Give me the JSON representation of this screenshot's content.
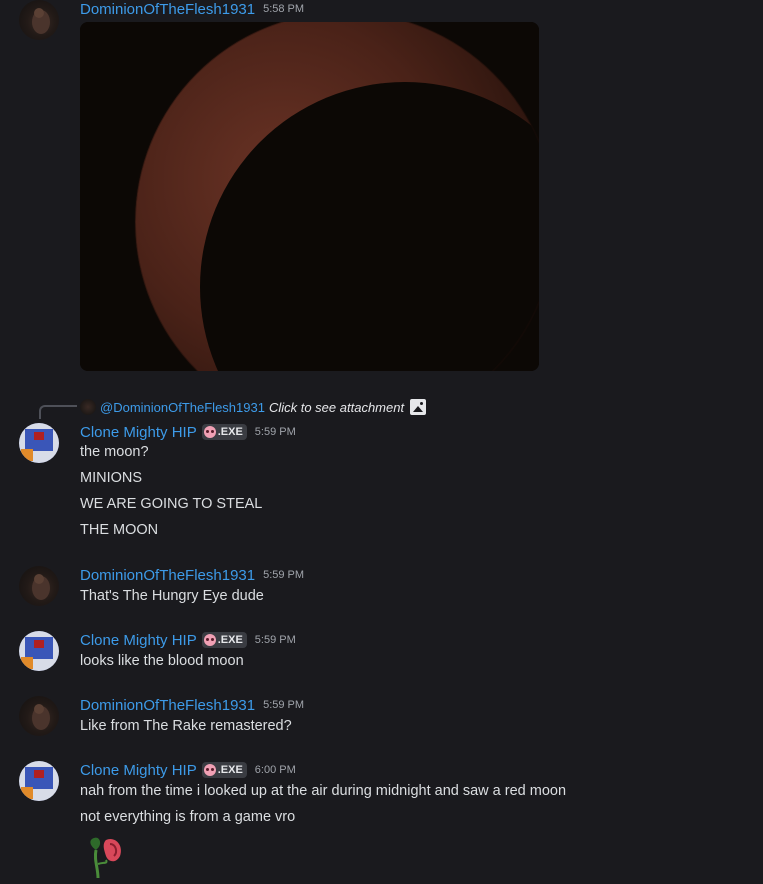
{
  "messages": [
    {
      "author": "DominionOfTheFlesh1931",
      "time": "5:58 PM",
      "attachment": {
        "alt": "moon-image"
      }
    },
    {
      "author": "Clone Mighty HIP",
      "tag": ".EXE",
      "time": "5:59 PM",
      "reply": {
        "mention": "@DominionOfTheFlesh1931",
        "text": "Click to see attachment"
      },
      "lines": [
        "the moon?",
        "MINIONS",
        "WE ARE GOING TO STEAL",
        "THE MOON"
      ]
    },
    {
      "author": "DominionOfTheFlesh1931",
      "time": "5:59 PM",
      "lines": [
        "That's The Hungry Eye dude"
      ]
    },
    {
      "author": "Clone Mighty HIP",
      "tag": ".EXE",
      "time": "5:59 PM",
      "lines": [
        "looks like the blood moon"
      ]
    },
    {
      "author": "DominionOfTheFlesh1931",
      "time": "5:59 PM",
      "lines": [
        "Like from The Rake remastered?"
      ]
    },
    {
      "author": "Clone Mighty HIP",
      "tag": ".EXE",
      "time": "6:00 PM",
      "lines": [
        "nah from the time i looked up at the air during midnight and saw a red moon",
        "not everything is from a game vro"
      ],
      "sticker": "wilted-rose-sticker"
    }
  ],
  "colors": {
    "username": "#3d9be9",
    "background": "#1a1a1e",
    "text": "#dbdee1"
  }
}
